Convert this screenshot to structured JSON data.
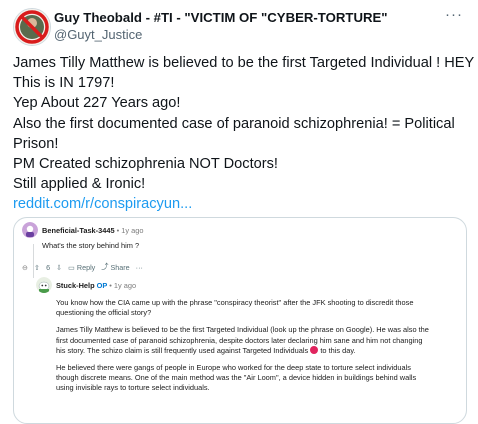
{
  "tweet": {
    "display_name": "Guy Theobald - #TI - \"VICTIM OF \"CYBER-TORTURE\"",
    "handle": "@Guyt_Justice",
    "more_icon": "more-horizontal-icon",
    "lines": [
      "James Tilly Matthew is believed to be the first Targeted Individual ! HEY",
      "This is IN 1797!",
      "Yep About 227 Years ago!",
      "Also the first documented case of paranoid schizophrenia! = Political",
      "Prison!",
      "PM Created schizophrenia NOT Doctors!",
      "Still applied & Ironic!"
    ],
    "link": "reddit.com/r/conspiracyun..."
  },
  "embed": {
    "comment1": {
      "username": "Beneficial-Task-3445",
      "time": "• 1y ago",
      "text": "What's the story behind him ?",
      "votes": "6",
      "reply": "Reply",
      "share": "Share",
      "more": "···"
    },
    "comment2": {
      "username": "Stuck-Help",
      "op": "OP",
      "time": "• 1y ago",
      "para1": [
        "You know how the CIA came up with the phrase \"conspiracy theorist\" after the JFK shooting to discredit those",
        "questioning the official story?"
      ],
      "para2": [
        "James Tilly Matthew is believed to be the first Targeted Individual (look up the phrase on Google). He was also the",
        "first documented case of paranoid schizophrenia, despite doctors later declaring him sane and him not changing",
        "his story. The schizo claim is still frequently used against Targeted Individuals",
        "to this day."
      ],
      "para3": [
        "He believed there were gangs of people in Europe who worked for the deep state to torture select individuals",
        "though discrete means. One of the main method was the \"Air Loom\", a device hidden in buildings behind walls",
        "using invisible rays to torture select individuals."
      ]
    }
  }
}
